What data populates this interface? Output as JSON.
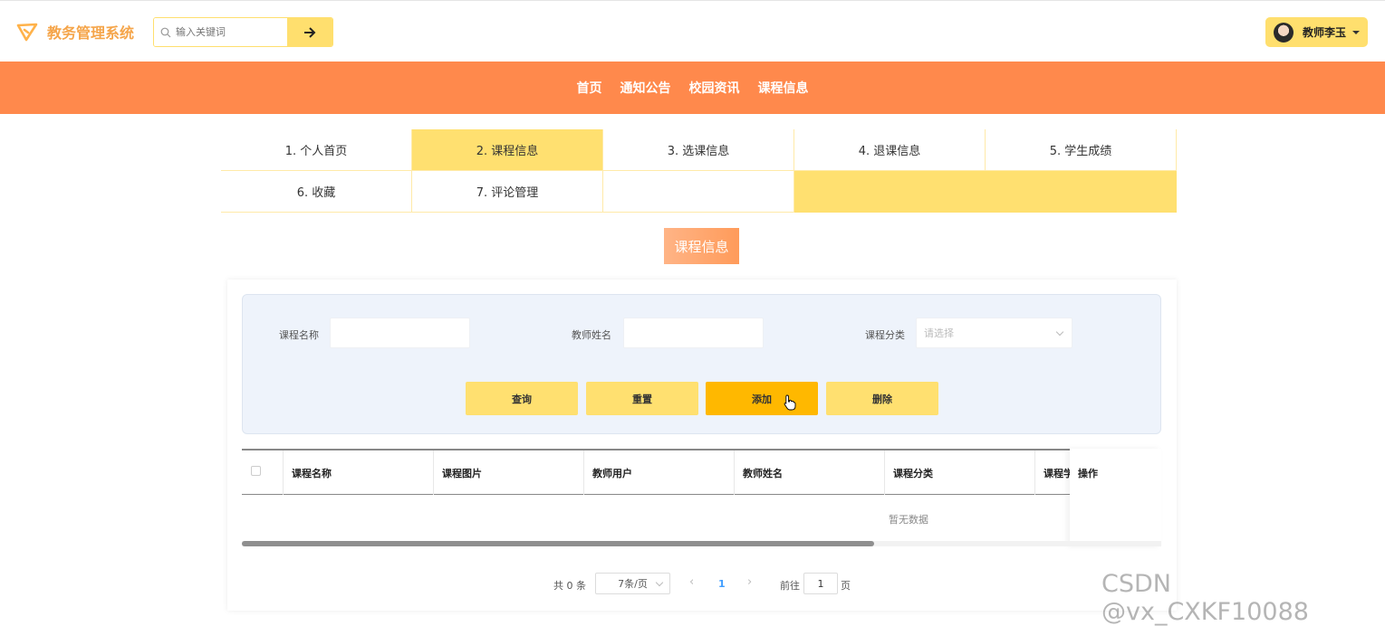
{
  "header": {
    "app_title": "教务管理系统",
    "search_placeholder": "输入关键词",
    "user_name": "教师李玉"
  },
  "nav": {
    "items": [
      "首页",
      "通知公告",
      "校园资讯",
      "课程信息"
    ]
  },
  "menu": {
    "items": [
      "1. 个人首页",
      "2. 课程信息",
      "3. 选课信息",
      "4. 退课信息",
      "5. 学生成绩",
      "6. 收藏",
      "7. 评论管理"
    ],
    "active_index": 1
  },
  "section_title": "课程信息",
  "filters": {
    "course_name_label": "课程名称",
    "teacher_name_label": "教师姓名",
    "category_label": "课程分类",
    "category_placeholder": "请选择"
  },
  "buttons": {
    "query": "查询",
    "reset": "重置",
    "add": "添加",
    "delete": "删除"
  },
  "table": {
    "columns": [
      "课程名称",
      "课程图片",
      "教师用户",
      "教师姓名",
      "课程分类",
      "课程学",
      "操作"
    ],
    "empty_text": "暂无数据"
  },
  "pagination": {
    "total": "共 0 条",
    "page_size": "7条/页",
    "current_page": "1",
    "goto_label": "前往",
    "goto_value": "1",
    "page_suffix": "页"
  },
  "watermark": "CSDN @vx_CXKF10088",
  "colors": {
    "accent_orange": "#ff894c",
    "accent_yellow": "#ffe070",
    "button_primary": "#ffb800",
    "logo_text": "#f5a54a"
  }
}
